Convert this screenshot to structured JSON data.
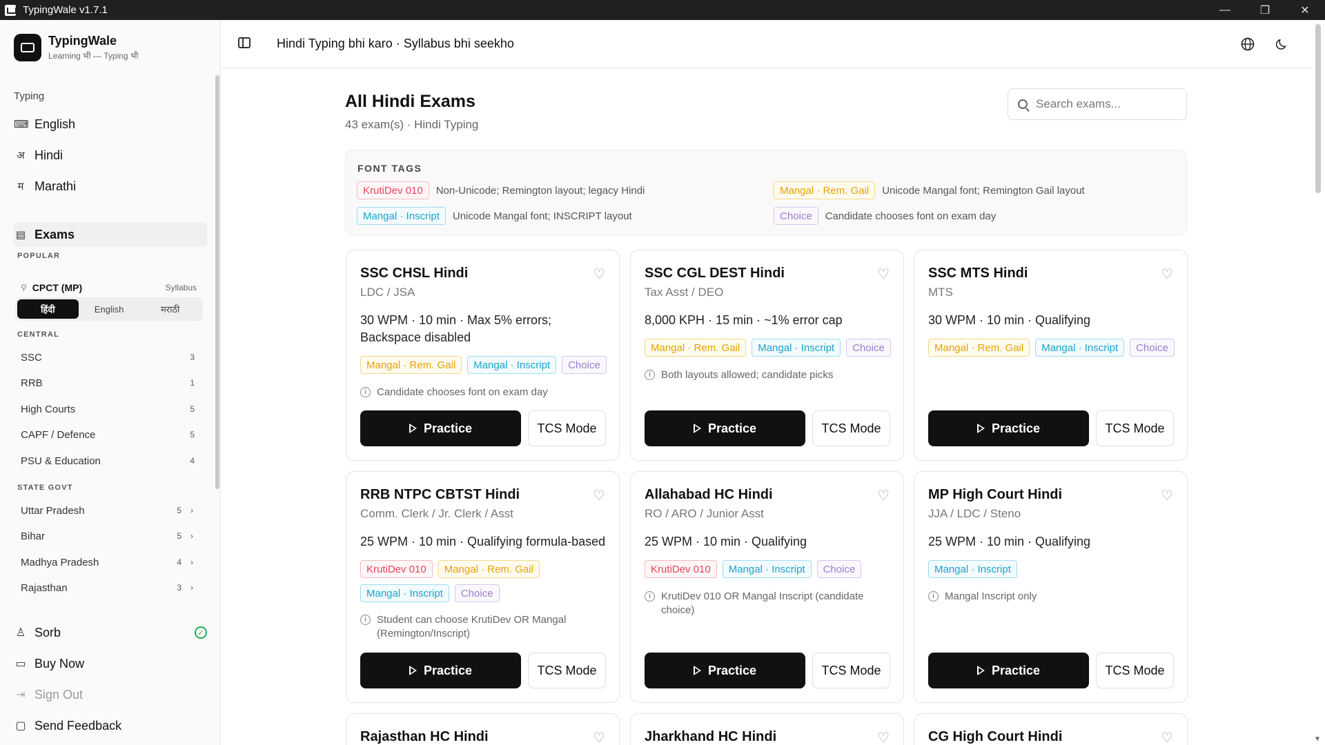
{
  "window": {
    "title": "TypingWale v1.7.1",
    "controls": [
      "—",
      "❐",
      "✕"
    ]
  },
  "brand": {
    "name": "TypingWale",
    "tagline": "Learning भी — Typing भी"
  },
  "sidebar": {
    "typing_label": "Typing",
    "typing_items": [
      {
        "label": "English",
        "icon": "keyboard-icon",
        "glyph": "⌨"
      },
      {
        "label": "Hindi",
        "icon": "devanagari-a-icon",
        "glyph": "अ"
      },
      {
        "label": "Marathi",
        "icon": "devanagari-ma-icon",
        "glyph": "म"
      }
    ],
    "exams_label": "Exams",
    "popular_label": "POPULAR",
    "popular_item": {
      "label": "CPCT (MP)",
      "syllabus": "Syllabus"
    },
    "lang_toggle": [
      "हिंदी",
      "English",
      "मराठी"
    ],
    "central_label": "CENTRAL",
    "central_items": [
      {
        "label": "SSC",
        "count": "3"
      },
      {
        "label": "RRB",
        "count": "1"
      },
      {
        "label": "High Courts",
        "count": "5"
      },
      {
        "label": "CAPF / Defence",
        "count": "5"
      },
      {
        "label": "PSU & Education",
        "count": "4"
      }
    ],
    "state_label": "STATE GOVT",
    "state_items": [
      {
        "label": "Uttar Pradesh",
        "count": "5"
      },
      {
        "label": "Bihar",
        "count": "5"
      },
      {
        "label": "Madhya Pradesh",
        "count": "4"
      },
      {
        "label": "Rajasthan",
        "count": "3"
      }
    ],
    "bottom": {
      "user": "Sorb",
      "buy": "Buy Now",
      "signout": "Sign Out",
      "feedback": "Send Feedback"
    }
  },
  "header": {
    "title": "Hindi Typing bhi karo · Syllabus bhi seekho"
  },
  "main": {
    "title": "All Hindi Exams",
    "subtitle": "43 exam(s) · Hindi Typing",
    "search_placeholder": "Search exams...",
    "font_tags_label": "FONT TAGS",
    "font_tags": [
      {
        "tag": "KrutiDev 010",
        "desc": "Non-Unicode; Remington layout; legacy Hindi"
      },
      {
        "tag": "Mangal · Rem. Gail",
        "desc": "Unicode Mangal font; Remington Gail layout"
      },
      {
        "tag": "Mangal · Inscript",
        "desc": "Unicode Mangal font; INSCRIPT layout"
      },
      {
        "tag": "Choice",
        "desc": "Candidate chooses font on exam day"
      }
    ],
    "practice_label": "Practice",
    "tcs_label": "TCS Mode",
    "cards": [
      {
        "title": "SSC CHSL Hindi",
        "role": "LDC / JSA",
        "spec": "30 WPM · 10 min · Max 5% errors; Backspace disabled",
        "tags": [
          "Mangal · Rem. Gail",
          "Mangal · Inscript",
          "Choice"
        ],
        "note": "Candidate chooses font on exam day"
      },
      {
        "title": "SSC CGL DEST Hindi",
        "role": "Tax Asst / DEO",
        "spec": "8,000 KPH · 15 min · ~1% error cap",
        "tags": [
          "Mangal · Rem. Gail",
          "Mangal · Inscript",
          "Choice"
        ],
        "note": "Both layouts allowed; candidate picks"
      },
      {
        "title": "SSC MTS Hindi",
        "role": "MTS",
        "spec": "30 WPM · 10 min · Qualifying",
        "tags": [
          "Mangal · Rem. Gail",
          "Mangal · Inscript",
          "Choice"
        ],
        "note": ""
      },
      {
        "title": "RRB NTPC CBTST Hindi",
        "role": "Comm. Clerk / Jr. Clerk / Asst",
        "spec": "25 WPM · 10 min · Qualifying formula-based",
        "tags": [
          "KrutiDev 010",
          "Mangal · Rem. Gail",
          "Mangal · Inscript",
          "Choice"
        ],
        "note": "Student can choose KrutiDev OR Mangal (Remington/Inscript)"
      },
      {
        "title": "Allahabad HC Hindi",
        "role": "RO / ARO / Junior Asst",
        "spec": "25 WPM · 10 min · Qualifying",
        "tags": [
          "KrutiDev 010",
          "Mangal · Inscript",
          "Choice"
        ],
        "note": "KrutiDev 010 OR Mangal Inscript (candidate choice)"
      },
      {
        "title": "MP High Court Hindi",
        "role": "JJA / LDC / Steno",
        "spec": "25 WPM · 10 min · Qualifying",
        "tags": [
          "Mangal · Inscript"
        ],
        "note": "Mangal Inscript only"
      },
      {
        "title": "Rajasthan HC Hindi"
      },
      {
        "title": "Jharkhand HC Hindi"
      },
      {
        "title": "CG High Court Hindi"
      }
    ]
  }
}
